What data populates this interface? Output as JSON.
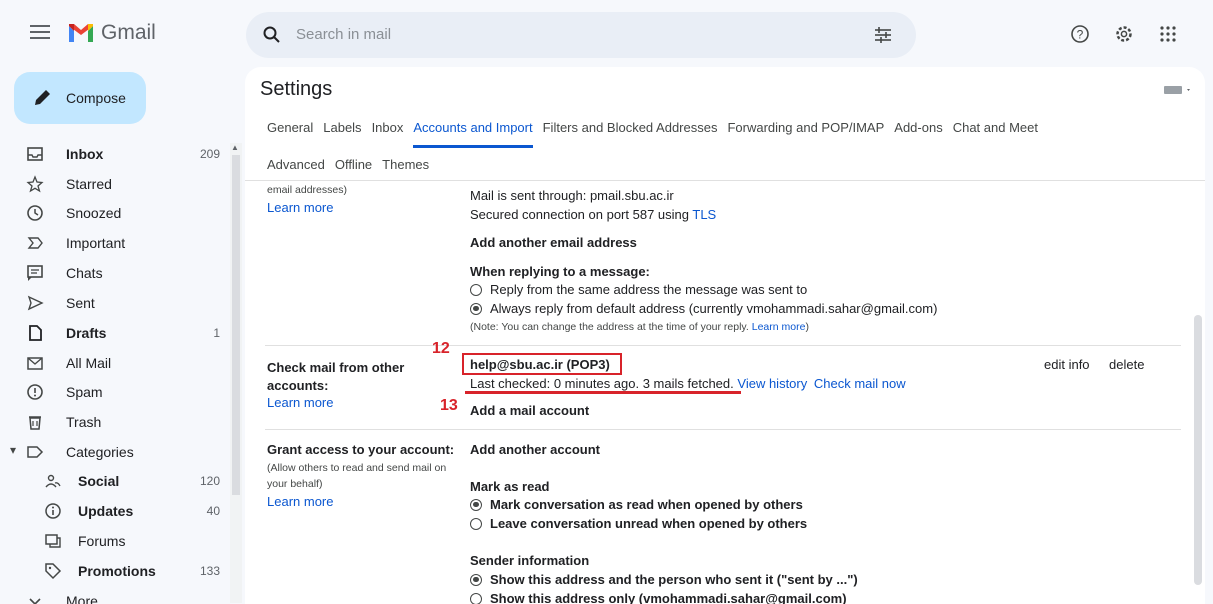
{
  "app": {
    "name": "Gmail"
  },
  "search": {
    "placeholder": "Search in mail"
  },
  "compose": {
    "label": "Compose"
  },
  "sidebar": {
    "items": [
      {
        "label": "Inbox",
        "count": "209",
        "icon": "inbox-icon",
        "bold": true
      },
      {
        "label": "Starred",
        "count": "",
        "icon": "star-icon"
      },
      {
        "label": "Snoozed",
        "count": "",
        "icon": "clock-icon"
      },
      {
        "label": "Important",
        "count": "",
        "icon": "important-icon"
      },
      {
        "label": "Chats",
        "count": "",
        "icon": "chat-icon"
      },
      {
        "label": "Sent",
        "count": "",
        "icon": "send-icon"
      },
      {
        "label": "Drafts",
        "count": "1",
        "icon": "draft-icon",
        "bold": true
      },
      {
        "label": "All Mail",
        "count": "",
        "icon": "all-mail-icon"
      },
      {
        "label": "Spam",
        "count": "",
        "icon": "spam-icon"
      },
      {
        "label": "Trash",
        "count": "",
        "icon": "trash-icon"
      },
      {
        "label": "Categories",
        "count": "",
        "icon": "label-icon"
      },
      {
        "label": "Social",
        "count": "120",
        "icon": "social-icon",
        "bold": true
      },
      {
        "label": "Updates",
        "count": "40",
        "icon": "info-icon",
        "bold": true
      },
      {
        "label": "Forums",
        "count": "",
        "icon": "forum-icon"
      },
      {
        "label": "Promotions",
        "count": "133",
        "icon": "tag-icon",
        "bold": true
      },
      {
        "label": "More",
        "count": "",
        "icon": "chevron-down-icon"
      }
    ]
  },
  "settings": {
    "title": "Settings",
    "tabs_row1": [
      "General",
      "Labels",
      "Inbox",
      "Accounts and Import",
      "Filters and Blocked Addresses",
      "Forwarding and POP/IMAP",
      "Add-ons",
      "Chat and Meet"
    ],
    "tabs_row2": [
      "Advanced",
      "Offline",
      "Themes"
    ],
    "active_tab": "Accounts and Import"
  },
  "send_mail": {
    "label_tail": "email addresses)",
    "learn_more": "Learn more",
    "sent_through": "Mail is sent through: pmail.sbu.ac.ir",
    "secured_prefix": "Secured connection on port 587 using",
    "secured_link": "TLS",
    "add_another": "Add another email address",
    "replying_heading": "When replying to a message:",
    "reply_option1": "Reply from the same address the message was sent to",
    "reply_option2": "Always reply from default address (currently vmohammadi.sahar@gmail.com)",
    "note_prefix": "(Note: You can change the address at the time of your reply.",
    "note_link": "Learn more",
    "note_suffix": ")"
  },
  "check_mail": {
    "label": "Check mail from other accounts:",
    "learn_more": "Learn more",
    "account": "help@sbu.ac.ir (POP3)",
    "status": "Last checked: 0 minutes ago. 3 mails fetched.",
    "view_history": "View history",
    "check_now": "Check mail now",
    "add_account": "Add a mail account",
    "edit_info": "edit info",
    "delete": "delete"
  },
  "grant_access": {
    "label": "Grant access to your account:",
    "sub": "(Allow others to read and send mail on your behalf)",
    "learn_more": "Learn more",
    "add_another": "Add another account",
    "mark_heading": "Mark as read",
    "mark_option1": "Mark conversation as read when opened by others",
    "mark_option2": "Leave conversation unread when opened by others",
    "sender_heading": "Sender information",
    "sender_option1": "Show this address and the person who sent it (\"sent by ...\")",
    "sender_option2": "Show this address only (vmohammadi.sahar@gmail.com)"
  },
  "annotations": {
    "n12": "12",
    "n13": "13",
    "color": "#d8232a"
  },
  "colors": {
    "accent": "#0b57d0",
    "compose_bg": "#c2e7ff",
    "page_bg": "#f6f8fc",
    "search_bg": "#e9eef6"
  }
}
